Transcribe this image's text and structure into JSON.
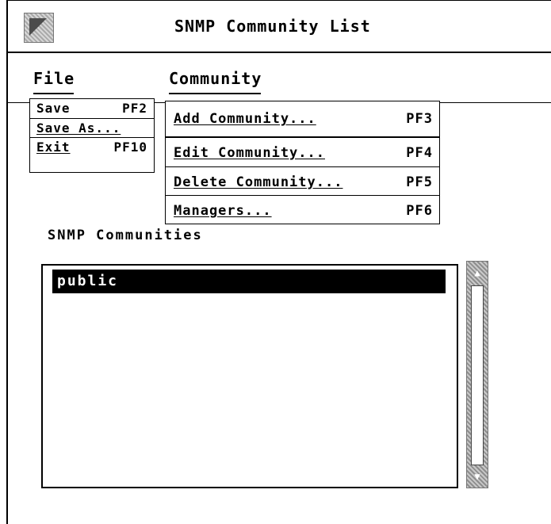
{
  "window": {
    "title": "SNMP Community List",
    "system_menu_icon": "system-menu-icon"
  },
  "menubar": {
    "file_label": "File",
    "community_label": "Community"
  },
  "file_menu": [
    {
      "label": "Save",
      "accelerator": "PF2"
    },
    {
      "label": "Save As...",
      "accelerator": ""
    },
    {
      "label": "Exit",
      "accelerator": "PF10"
    }
  ],
  "community_menu": [
    {
      "label": "Add Community...",
      "accelerator": "PF3"
    },
    {
      "label": "Edit Community...",
      "accelerator": "PF4"
    },
    {
      "label": "Delete Community...",
      "accelerator": "PF5"
    },
    {
      "label": "Managers...",
      "accelerator": "PF6"
    }
  ],
  "communities": {
    "label": "SNMP Communities",
    "items": [
      "public"
    ],
    "selected": "public"
  },
  "scrollbar": {
    "up_icon": "arrow-up-icon",
    "down_icon": "arrow-down-icon"
  }
}
